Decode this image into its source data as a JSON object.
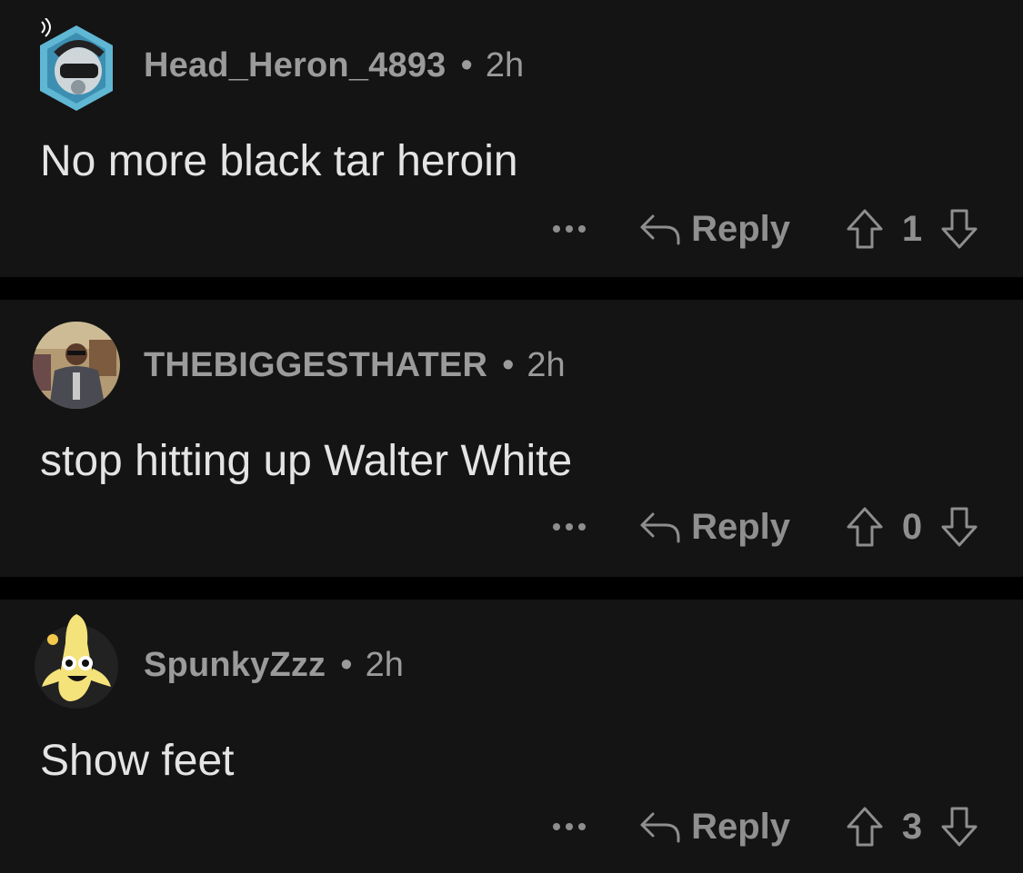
{
  "colors": {
    "background": "#000000",
    "card": "#141414",
    "meta_text": "#9b9b9b",
    "body_text": "#e4e4e4",
    "action_text": "#8f8f8f"
  },
  "comments": [
    {
      "username": "Head_Heron_4893",
      "separator": "•",
      "time": "2h",
      "text": "No more black tar heroin",
      "reply_label": "Reply",
      "vote_count": "1",
      "avatar_icon": "snoo-helmet-avatar-icon"
    },
    {
      "username": "THEBIGGESTHATER",
      "separator": "•",
      "time": "2h",
      "text": "stop hitting up Walter White",
      "reply_label": "Reply",
      "vote_count": "0",
      "avatar_icon": "photo-avatar-icon"
    },
    {
      "username": "SpunkyZzz",
      "separator": "•",
      "time": "2h",
      "text": "Show feet",
      "reply_label": "Reply",
      "vote_count": "3",
      "avatar_icon": "banana-avatar-icon"
    }
  ],
  "icons": {
    "more": "more-options-icon",
    "reply": "reply-arrow-icon",
    "upvote": "upvote-arrow-icon",
    "downvote": "downvote-arrow-icon"
  }
}
